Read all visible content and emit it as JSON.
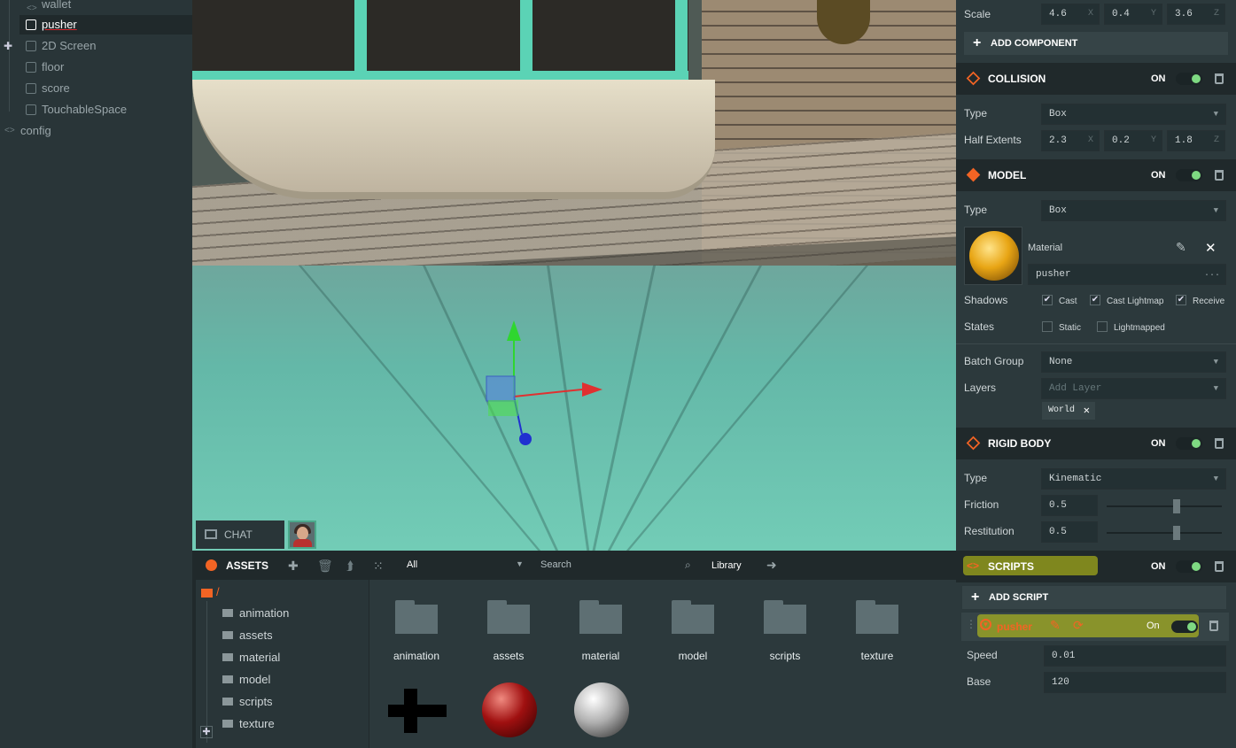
{
  "hierarchy": {
    "items": [
      {
        "label": "wallet"
      },
      {
        "label": "pusher"
      },
      {
        "label": "2D Screen"
      },
      {
        "label": "floor"
      },
      {
        "label": "score"
      },
      {
        "label": "TouchableSpace"
      },
      {
        "label": "config"
      }
    ]
  },
  "chat": {
    "label": "CHAT"
  },
  "assets": {
    "title": "ASSETS",
    "filter": "All",
    "search_placeholder": "Search",
    "library_label": "Library",
    "root": "/",
    "tree": [
      "animation",
      "assets",
      "material",
      "model",
      "scripts",
      "texture"
    ],
    "grid_folders": [
      "animation",
      "assets",
      "material",
      "model",
      "scripts",
      "texture"
    ],
    "grid_items_icons": [
      "model-cross-icon",
      "red-material-sphere-icon",
      "white-material-sphere-icon"
    ]
  },
  "inspector": {
    "scale": {
      "label": "Scale",
      "x": "4.6",
      "y": "0.4",
      "z": "3.6",
      "ax": "X",
      "ay": "Y",
      "az": "Z"
    },
    "add_component": "ADD COMPONENT",
    "collision": {
      "title": "COLLISION",
      "on": "ON",
      "type_label": "Type",
      "type_value": "Box",
      "half_label": "Half Extents",
      "hx": "2.3",
      "hy": "0.2",
      "hz": "1.8"
    },
    "model": {
      "title": "MODEL",
      "on": "ON",
      "type_label": "Type",
      "type_value": "Box",
      "material_label": "Material",
      "material_value": "pusher",
      "material_more": "...",
      "shadows_label": "Shadows",
      "cast": "Cast",
      "cast_lightmap": "Cast Lightmap",
      "receive": "Receive",
      "states_label": "States",
      "static": "Static",
      "lightmapped": "Lightmapped",
      "batch_label": "Batch Group",
      "batch_value": "None",
      "layers_label": "Layers",
      "layers_placeholder": "Add Layer",
      "layer_tag": "World"
    },
    "rigidbody": {
      "title": "RIGID BODY",
      "on": "ON",
      "type_label": "Type",
      "type_value": "Kinematic",
      "friction_label": "Friction",
      "friction_value": "0.5",
      "restitution_label": "Restitution",
      "restitution_value": "0.5",
      "friction_level": 0.5,
      "restitution_level": 0.5
    },
    "scripts": {
      "title": "SCRIPTS",
      "on": "ON",
      "add_script": "ADD SCRIPT",
      "script_name": "pusher",
      "script_on": "On",
      "speed_label": "Speed",
      "speed_value": "0.01",
      "base_label": "Base",
      "base_value": "120"
    }
  },
  "colors": {
    "accent": "#f26424",
    "toggle_on": "#7ed982",
    "panel": "#2c393c",
    "highlight": "#cdd514"
  }
}
